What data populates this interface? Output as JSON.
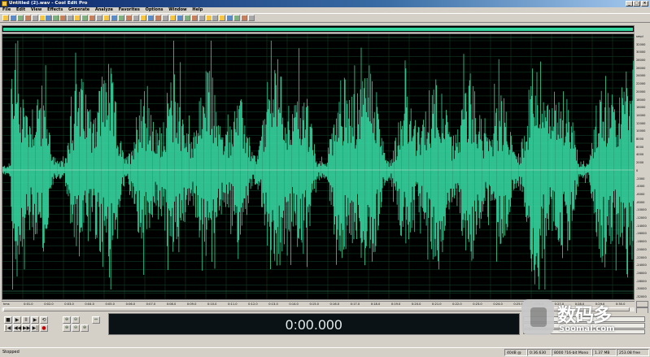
{
  "window": {
    "title": "Untitled (2).wav - Cool Edit Pro",
    "buttons": [
      "_",
      "□",
      "×"
    ]
  },
  "menu": [
    "File",
    "Edit",
    "View",
    "Effects",
    "Generate",
    "Analyze",
    "Favorites",
    "Options",
    "Window",
    "Help"
  ],
  "colors": {
    "waveform": "#35d6a0",
    "background": "#000000",
    "grid": "#0f3d22",
    "centerline": "#9dd8bf"
  },
  "db_ruler": [
    "smpl",
    "32000",
    "30000",
    "28000",
    "26000",
    "24000",
    "22000",
    "20000",
    "18000",
    "16000",
    "14000",
    "12000",
    "10000",
    "8000",
    "6000",
    "4000",
    "2000",
    "0",
    "-2000",
    "-4000",
    "-6000",
    "-8000",
    "-10000",
    "-12000",
    "-14000",
    "-16000",
    "-18000",
    "-20000",
    "-22000",
    "-24000",
    "-26000",
    "-28000",
    "-30000",
    "-32000"
  ],
  "time_ruler": [
    "hms",
    "0:01.0",
    "0:02.0",
    "0:03.0",
    "0:04.0",
    "0:05.0",
    "0:06.0",
    "0:07.0",
    "0:08.0",
    "0:09.0",
    "0:10.0",
    "0:11.0",
    "0:12.0",
    "0:13.0",
    "0:14.0",
    "0:15.0",
    "0:16.0",
    "0:17.0",
    "0:18.0",
    "0:19.0",
    "0:20.0",
    "0:21.0",
    "0:22.0",
    "0:23.0",
    "0:24.0",
    "0:25.0",
    "0:26.0",
    "0:27.0",
    "0:28.0",
    "0:29.0",
    "0:30.0"
  ],
  "transport": {
    "row1": [
      "■",
      "▶",
      "II",
      "▶",
      "⟲"
    ],
    "row2": [
      "|◀",
      "◀◀",
      "▶▶",
      "▶|",
      "●"
    ]
  },
  "zoom": {
    "row1": [
      "⊕",
      "⊖",
      "⇔"
    ],
    "row2": [
      "⊕",
      "⊖",
      "⊕"
    ]
  },
  "time_display": "0:00.000",
  "status": {
    "text": "Stopped",
    "panes": [
      "40dB @",
      "0:36.630",
      "8000 ?16-bit Mono",
      "1.37 MB",
      "253.08 free"
    ]
  },
  "watermark": {
    "chinese": "数码多",
    "site": "Soomal.com"
  }
}
